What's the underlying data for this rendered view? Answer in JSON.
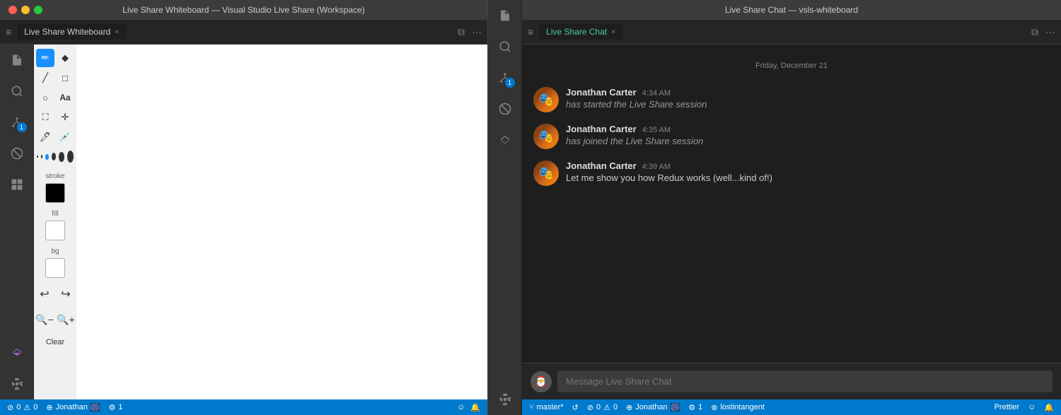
{
  "left_window": {
    "titlebar": "Live Share Whiteboard — Visual Studio Live Share (Workspace)",
    "tab_label": "Live Share Whiteboard",
    "tab_close": "×"
  },
  "right_window": {
    "titlebar": "Live Share Chat — vsls-whiteboard",
    "tab_label": "Live Share Chat",
    "tab_close": "×"
  },
  "tools": {
    "stroke_label": "stroke",
    "fill_label": "fill",
    "bg_label": "bg",
    "clear_label": "Clear"
  },
  "chat": {
    "date_divider": "Friday, December 21",
    "input_placeholder": "Message Live Share Chat",
    "messages": [
      {
        "author": "Jonathan Carter",
        "time": "4:34 AM",
        "text": "has started the Live Share session",
        "italic": true
      },
      {
        "author": "Jonathan Carter",
        "time": "4:35 AM",
        "text": "has joined the Live Share session",
        "italic": true
      },
      {
        "author": "Jonathan Carter",
        "time": "4:39 AM",
        "text": "Let me show you how Redux works (well...kind of!)",
        "italic": false
      }
    ]
  },
  "left_statusbar": {
    "errors": "0",
    "warnings": "0",
    "user": "Jonathan",
    "emoji": "🎆",
    "guests": "1",
    "smiley": "☺",
    "bell": "🔔"
  },
  "right_statusbar": {
    "branch": "master*",
    "sync": "↺",
    "errors": "0",
    "warnings": "0",
    "user": "Jonathan",
    "emoji": "🎆",
    "guests": "1",
    "repo": "lostintangent",
    "prettier": "Prettier",
    "smiley": "☺",
    "bell": "🔔"
  },
  "sidebar_icons": {
    "files": "📄",
    "search": "🔍",
    "git": "⑂",
    "debug": "🚫",
    "extensions": "⊞",
    "liveshare": "↗",
    "settings": "⚙"
  },
  "badge": "1"
}
